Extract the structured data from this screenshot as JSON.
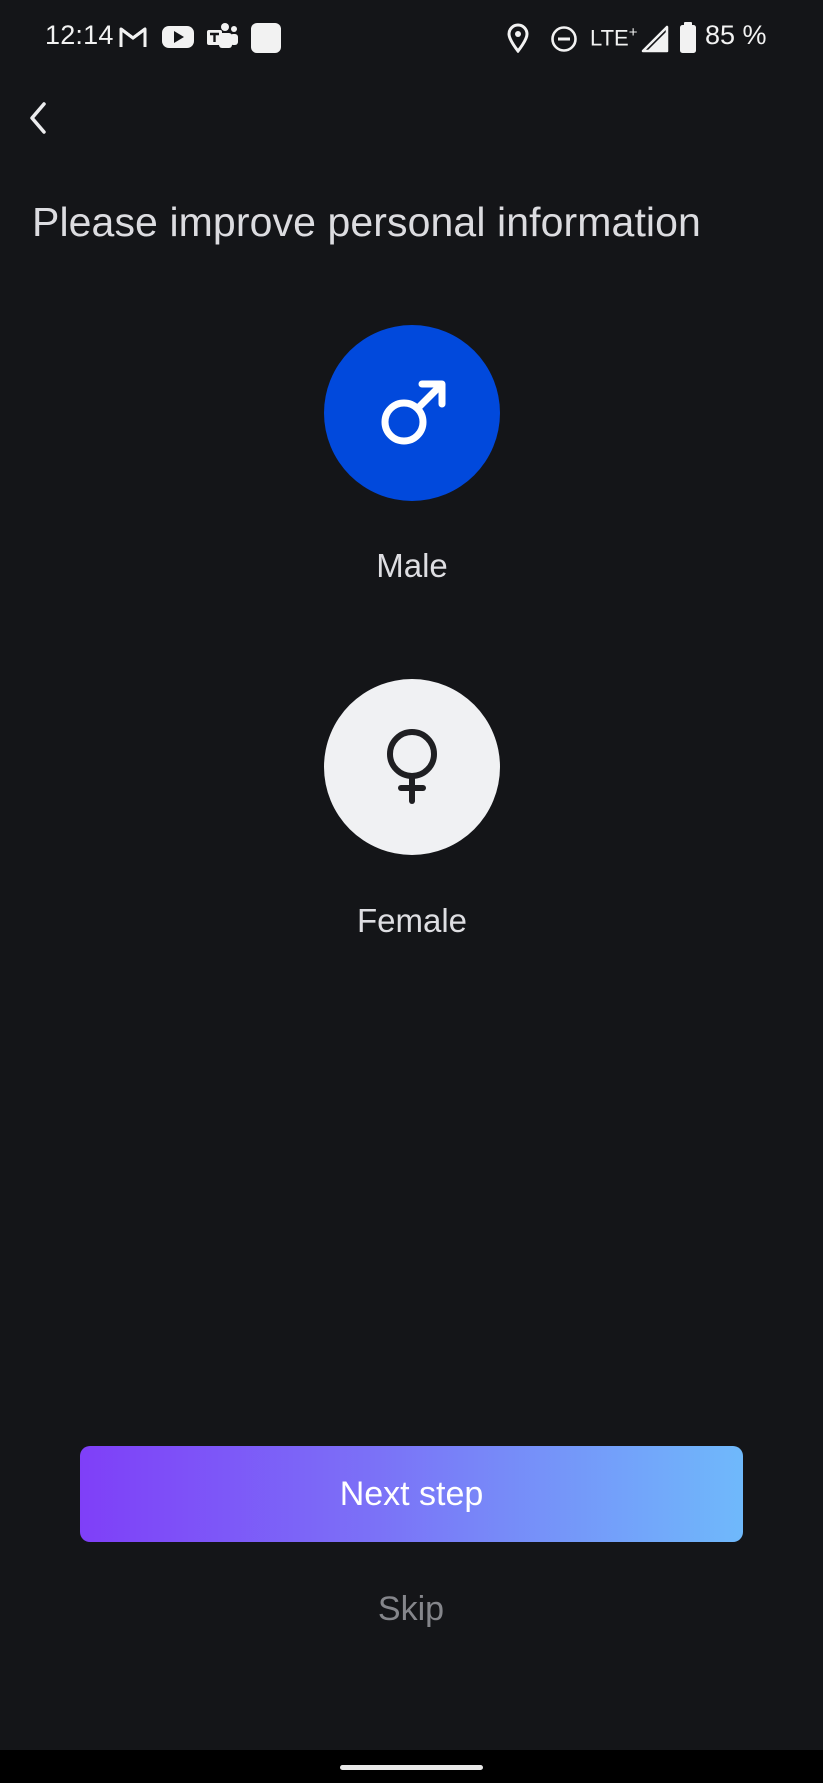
{
  "status_bar": {
    "time": "12:14",
    "network": "LTE",
    "network_plus": "+",
    "battery": "85 %",
    "icons": [
      "gmail-icon",
      "youtube-icon",
      "teams-icon",
      "app-square-icon",
      "location-icon",
      "do-not-disturb-icon",
      "signal-icon",
      "battery-icon"
    ]
  },
  "header": {
    "back_icon": "back-arrow-icon",
    "title": "Please improve personal information"
  },
  "gender": {
    "selected": "male",
    "options": [
      {
        "id": "male",
        "label": "Male",
        "icon": "male-symbol-icon"
      },
      {
        "id": "female",
        "label": "Female",
        "icon": "female-symbol-icon"
      }
    ]
  },
  "actions": {
    "next_label": "Next step",
    "skip_label": "Skip"
  },
  "colors": {
    "background": "#141518",
    "male_selected": "#0149dc",
    "female_unselected": "#f0f1f3",
    "gradient_start": "#7f3ff8",
    "gradient_end": "#6fb9fb",
    "skip_text": "#85868b"
  }
}
